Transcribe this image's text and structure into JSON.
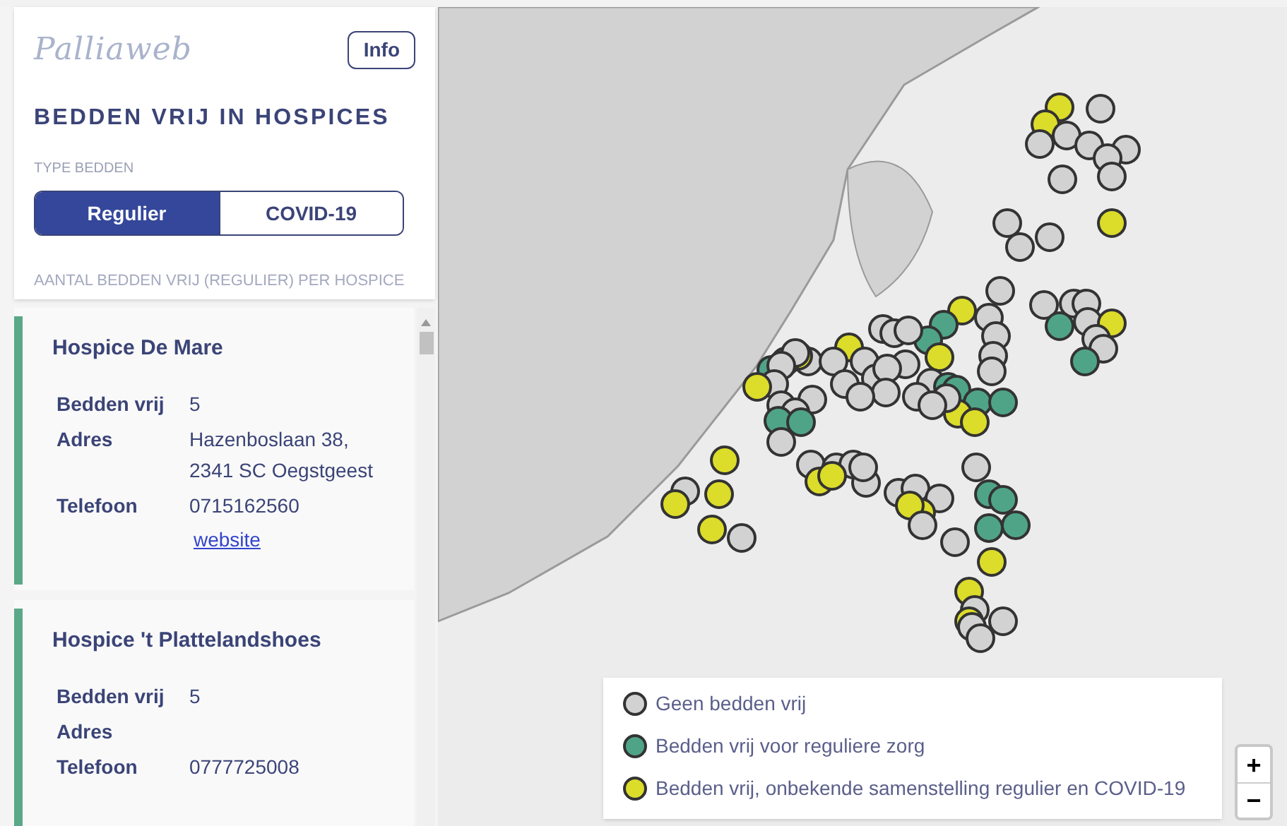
{
  "logo": "Palliaweb",
  "info_button": "Info",
  "title": "BEDDEN VRIJ IN HOSPICES",
  "type_label": "TYPE BEDDEN",
  "type_tabs": [
    {
      "label": "Regulier",
      "selected": true
    },
    {
      "label": "COVID-19",
      "selected": false
    }
  ],
  "list_heading": "AANTAL BEDDEN VRIJ (REGULIER) PER HOSPICE",
  "hospices": [
    {
      "name": "Hospice De Mare",
      "color": "#5aa888",
      "fields": [
        {
          "label": "Bedden vrij",
          "value": [
            "5"
          ]
        },
        {
          "label": "Adres",
          "value": [
            "Hazenboslaan 38,",
            "2341 SC Oegstgeest"
          ]
        },
        {
          "label": "Telefoon",
          "value": [
            "0715162560"
          ]
        }
      ],
      "link": "website"
    },
    {
      "name": "Hospice 't Plattelandshoes",
      "color": "#5aa888",
      "fields": [
        {
          "label": "Bedden vrij",
          "value": [
            "5"
          ]
        },
        {
          "label": "Adres"
        },
        {
          "label": "Telefoon",
          "value": [
            "0777725008"
          ]
        }
      ]
    }
  ],
  "legend": [
    {
      "label": "Geen bedden vrij",
      "color": "#d2d2d2"
    },
    {
      "label": "Bedden vrij voor reguliere zorg",
      "color": "#4fa487"
    },
    {
      "label": "Bedden vrij, onbekende samenstelling regulier en COVID-19",
      "color": "#dcdc2a"
    }
  ],
  "zoom_controls": [
    "+",
    "−"
  ]
}
